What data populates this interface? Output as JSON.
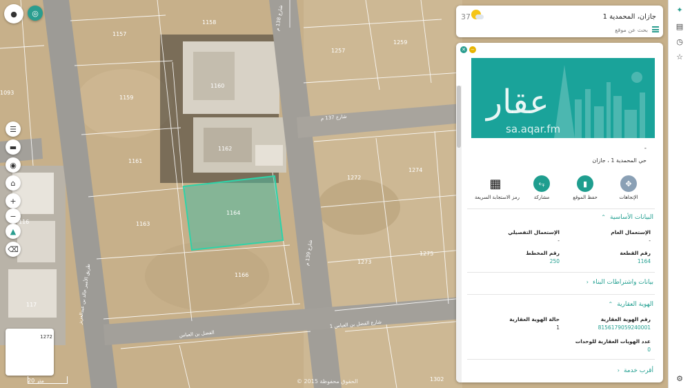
{
  "map": {
    "plots": [
      {
        "id": "1157"
      },
      {
        "id": "1158"
      },
      {
        "id": "1159"
      },
      {
        "id": "1160"
      },
      {
        "id": "1161"
      },
      {
        "id": "1162"
      },
      {
        "id": "1163"
      },
      {
        "id": "1164"
      },
      {
        "id": "1166"
      },
      {
        "id": "1257"
      },
      {
        "id": "1259"
      },
      {
        "id": "1272"
      },
      {
        "id": "1273"
      },
      {
        "id": "1274"
      },
      {
        "id": "1275"
      },
      {
        "id": "1302"
      },
      {
        "id": "1093"
      },
      {
        "id": "116"
      },
      {
        "id": "117"
      }
    ],
    "streets": {
      "s137": "شارع 137 م",
      "s138": "شارع 138 م",
      "s139": "شارع 139 م",
      "fadl": "الفضل بن العباس",
      "fadl_b": "شارع الفضل بن العباس 1",
      "west": "طريق الأمير خالد بن عبدالعزيز"
    },
    "selected_plot": "1164",
    "scale_label": "20 متر",
    "copyright": "© 2015 الحقوق محفوظة",
    "minimap_label": "1272"
  },
  "header": {
    "temperature": "37°",
    "location_title": "جازان، المحمدية 1",
    "search_placeholder": "بحث عن موقع",
    "weather_icon": "sun-cloud-icon"
  },
  "panel": {
    "banner_logo": "عقار",
    "banner_url": "sa.aqar.fm",
    "dash": "-",
    "district": "حي المحمدية 1 ، جازان",
    "actions": [
      {
        "label": "الإتجاهات",
        "icon": "directions-icon"
      },
      {
        "label": "حفظ الموقع",
        "icon": "bookmark-icon"
      },
      {
        "label": "مشاركة",
        "icon": "share-icon"
      },
      {
        "label": "رمز الاستجابة السريعة",
        "icon": "qr-code-icon"
      }
    ],
    "basic": {
      "title": "البيانات الأساسية",
      "general_use_label": "الإستعمال العام",
      "general_use_value": "-",
      "detailed_use_label": "الإستعمال التفصيلي",
      "detailed_use_value": "-",
      "plot_no_label": "رقم القطعة",
      "plot_no_value": "1164",
      "plan_no_label": "رقم المخطط",
      "plan_no_value": "250"
    },
    "building": {
      "title": "بيانات واشتراطات البناء"
    },
    "identity": {
      "title": "الهوية العقارية",
      "id_label": "رقم الهوية العقارية",
      "id_value": "8156179059240001",
      "status_label": "حالة الهوية العقارية",
      "status_value": "1",
      "units_label": "عدد الهويات العقارية للوحدات",
      "units_value": "0"
    },
    "nearest": {
      "title": "أقرب خدمة"
    }
  },
  "colors": {
    "accent": "#1f9e8f",
    "selected_fill": "#4fb9a0",
    "banner": "#1aa39a"
  }
}
